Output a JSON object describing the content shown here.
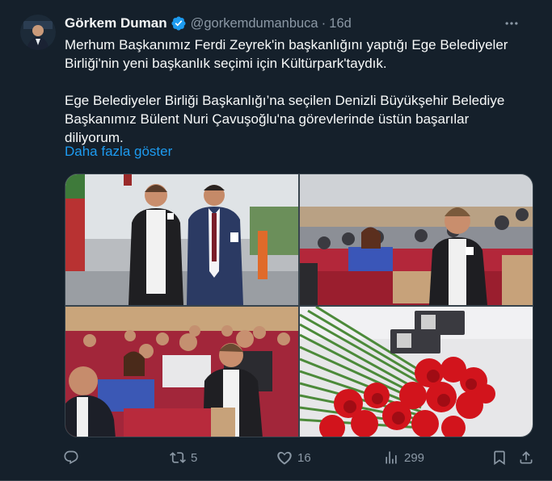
{
  "author": {
    "name": "Görkem Duman",
    "handle": "@gorkemdumanbuca",
    "separator": "·",
    "time": "16d"
  },
  "tweet": {
    "paragraph1": "Merhum Başkanımız Ferdi Zeyrek'in başkanlığını yaptığı Ege Belediyeler Birliği'nin yeni başkanlık seçimi için Kültürpark'taydık.",
    "paragraph2": "Ege Belediyeler Birliği Başkanlığı’na seçilen Denizli Büyükşehir Belediye Başkanımız Bülent Nuri Çavuşoğlu'na görevlerinde üstün başarılar diliyorum.",
    "show_more": "Daha fazla göster"
  },
  "actions": {
    "replies": "",
    "retweets": "5",
    "likes": "16",
    "views": "299"
  },
  "colors": {
    "background": "#15202b",
    "accent": "#1d9bf0",
    "muted": "#8b98a5"
  },
  "icons": [
    "verified-badge-icon",
    "more-icon",
    "reply-icon",
    "retweet-icon",
    "like-icon",
    "views-icon",
    "bookmark-icon",
    "share-icon"
  ]
}
